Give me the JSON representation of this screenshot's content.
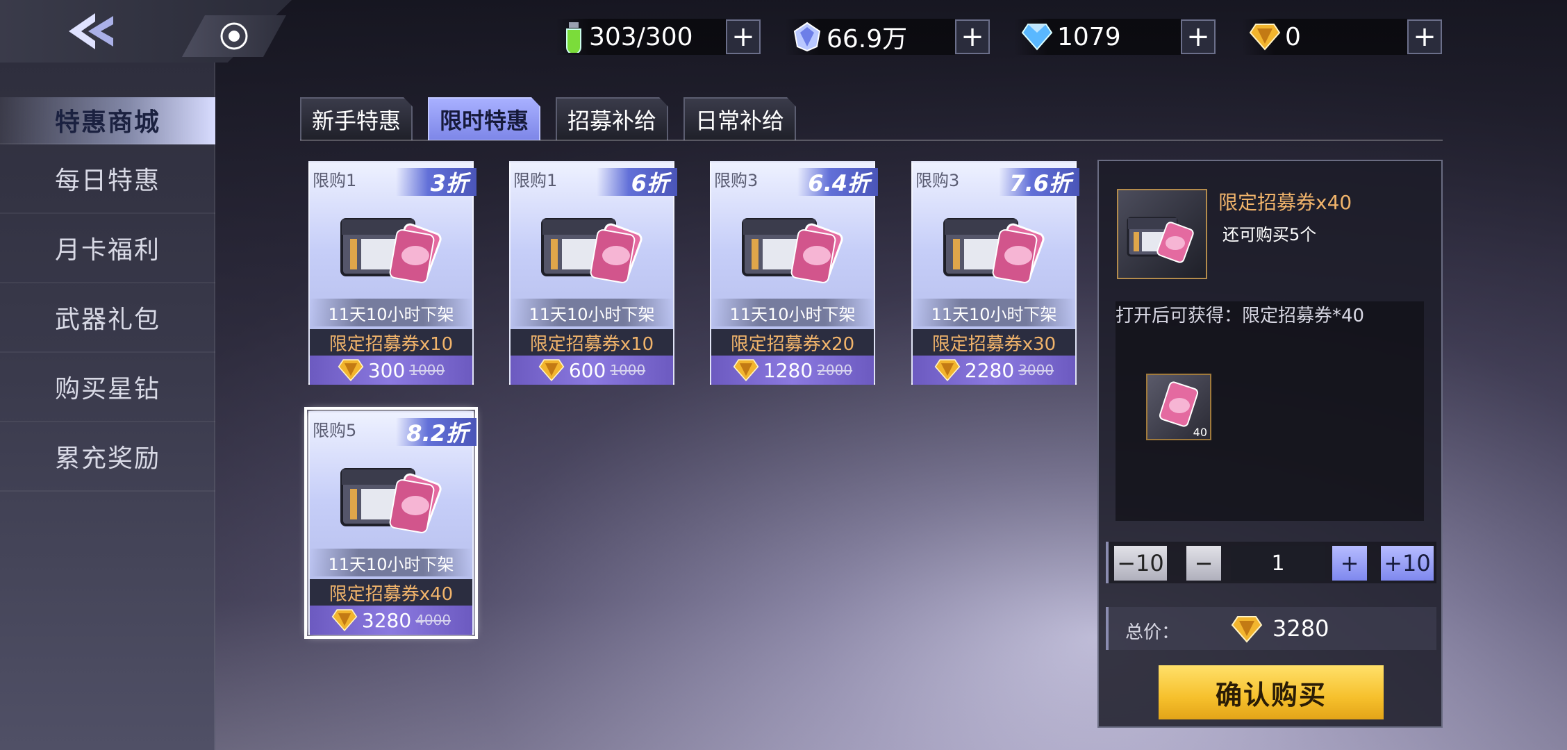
{
  "sidebar": {
    "items": [
      {
        "label": "特惠商城",
        "active": true
      },
      {
        "label": "每日特惠",
        "active": false
      },
      {
        "label": "月卡福利",
        "active": false
      },
      {
        "label": "武器礼包",
        "active": false
      },
      {
        "label": "购买星钻",
        "active": false
      },
      {
        "label": "累充奖励",
        "active": false
      }
    ]
  },
  "resources": {
    "stamina": "303/300",
    "crystal": "66.9万",
    "diamond": "1079",
    "star_diamond": "0"
  },
  "tabs": [
    {
      "label": "新手特惠",
      "active": false
    },
    {
      "label": "限时特惠",
      "active": true
    },
    {
      "label": "招募补给",
      "active": false
    },
    {
      "label": "日常补给",
      "active": false
    }
  ],
  "products": [
    {
      "limit": "限购1",
      "discount": "3折",
      "timer": "11天10小时下架",
      "name": "限定招募券x10",
      "price": "300",
      "old_price": "1000"
    },
    {
      "limit": "限购1",
      "discount": "6折",
      "timer": "11天10小时下架",
      "name": "限定招募券x10",
      "price": "600",
      "old_price": "1000"
    },
    {
      "limit": "限购3",
      "discount": "6.4折",
      "timer": "11天10小时下架",
      "name": "限定招募券x20",
      "price": "1280",
      "old_price": "2000"
    },
    {
      "limit": "限购3",
      "discount": "7.6折",
      "timer": "11天10小时下架",
      "name": "限定招募券x30",
      "price": "2280",
      "old_price": "3000"
    },
    {
      "limit": "限购5",
      "discount": "8.2折",
      "timer": "11天10小时下架",
      "name": "限定招募券x40",
      "price": "3280",
      "old_price": "4000",
      "selected": true
    }
  ],
  "detail": {
    "name": "限定招募券x40",
    "remaining": "还可购买5个",
    "reward_title": "打开后可获得：限定招募券*40",
    "reward_count": "40",
    "qty_minus10": "−10",
    "qty_minus": "−",
    "quantity": "1",
    "qty_plus": "+",
    "qty_plus10": "+10",
    "total_label": "总价：",
    "total_value": "3280",
    "confirm_label": "确认购买"
  },
  "colors": {
    "accent_blue": "#7d86e8",
    "gold": "#f6c02c",
    "item_name_orange": "#f1b46b",
    "price_purple": "#8b79e0"
  }
}
